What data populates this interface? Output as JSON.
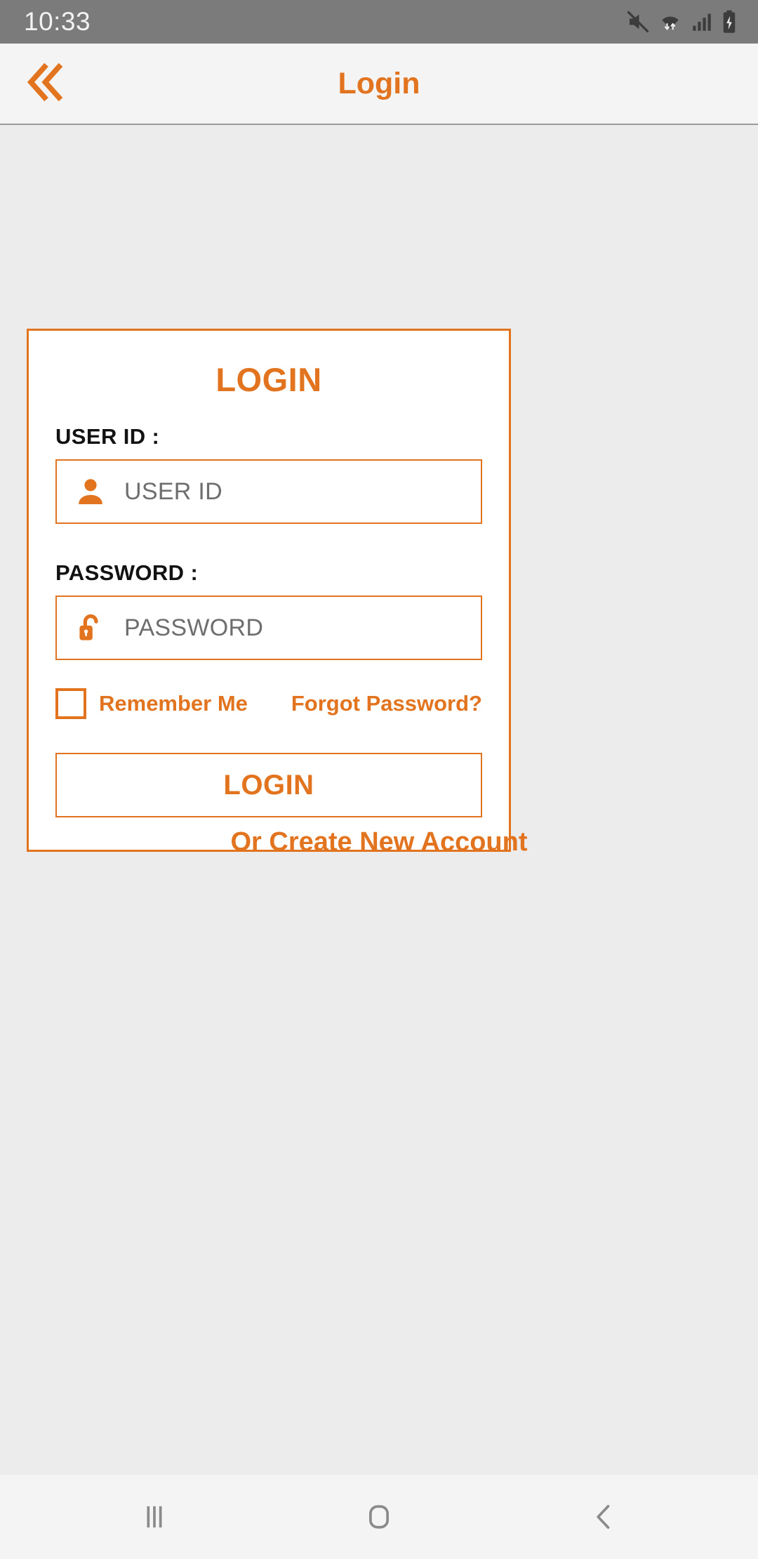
{
  "status_bar": {
    "time": "10:33",
    "icons": [
      "mute-icon",
      "wifi-icon",
      "cellular-signal-icon",
      "battery-charging-icon"
    ],
    "background_color": "#7b7b7b"
  },
  "header": {
    "title": "Login",
    "back_icon": "double-chevron-left-icon",
    "accent_color": "#e2741f"
  },
  "login_card": {
    "title": "LOGIN",
    "user_id": {
      "label": "USER ID :",
      "placeholder": "USER ID",
      "value": "",
      "icon": "person-icon"
    },
    "password": {
      "label": "PASSWORD :",
      "placeholder": "PASSWORD",
      "value": "",
      "icon": "unlocked-padlock-icon"
    },
    "remember_me": {
      "label": "Remember Me",
      "checked": false
    },
    "forgot_password": "Forgot Password?",
    "submit_label": "LOGIN",
    "border_color": "#e2741f",
    "background_color": "#ffffff"
  },
  "create_account": "Or Create New Account",
  "nav_bar": {
    "recents": "recents-icon",
    "home": "home-icon",
    "back": "back-icon"
  },
  "theme": {
    "accent": "#e2741f",
    "page_background": "#ececec",
    "label_text": "#121212",
    "placeholder_text": "#6e6e6e"
  }
}
